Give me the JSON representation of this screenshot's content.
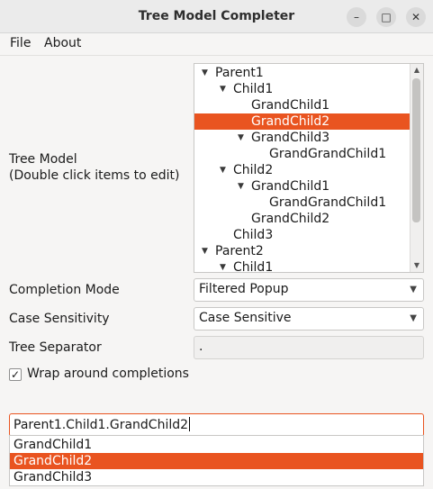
{
  "window": {
    "title": "Tree Model Completer",
    "buttons": {
      "minimize": "–",
      "maximize": "□",
      "close": "✕"
    }
  },
  "menu": {
    "file": "File",
    "about": "About"
  },
  "tree_model": {
    "label_line1": "Tree Model",
    "label_line2": "(Double click items to edit)",
    "items": [
      {
        "text": "Parent1",
        "expanded": true
      },
      {
        "text": "Child1",
        "expanded": true
      },
      {
        "text": "GrandChild1"
      },
      {
        "text": "GrandChild2",
        "selected": true
      },
      {
        "text": "GrandChild3",
        "expanded": true
      },
      {
        "text": "GrandGrandChild1"
      },
      {
        "text": "Child2",
        "expanded": true
      },
      {
        "text": "GrandChild1",
        "expanded": true
      },
      {
        "text": "GrandGrandChild1"
      },
      {
        "text": "GrandChild2"
      },
      {
        "text": "Child3"
      },
      {
        "text": "Parent2",
        "expanded": true
      },
      {
        "text": "Child1",
        "expanded": true
      }
    ],
    "expand_glyph": "▼"
  },
  "completion_mode": {
    "label": "Completion Mode",
    "value": "Filtered Popup"
  },
  "case_sensitivity": {
    "label": "Case Sensitivity",
    "value": "Case Sensitive"
  },
  "tree_separator": {
    "label": "Tree Separator",
    "value": "."
  },
  "wrap": {
    "label": "Wrap around completions",
    "checked": true,
    "mark": "✓"
  },
  "completer_input": {
    "value": "Parent1.Child1.GrandChild2"
  },
  "popup": {
    "items": [
      "GrandChild1",
      "GrandChild2",
      "GrandChild3"
    ],
    "selected_index": 1
  },
  "colors": {
    "accent": "#e95420"
  }
}
